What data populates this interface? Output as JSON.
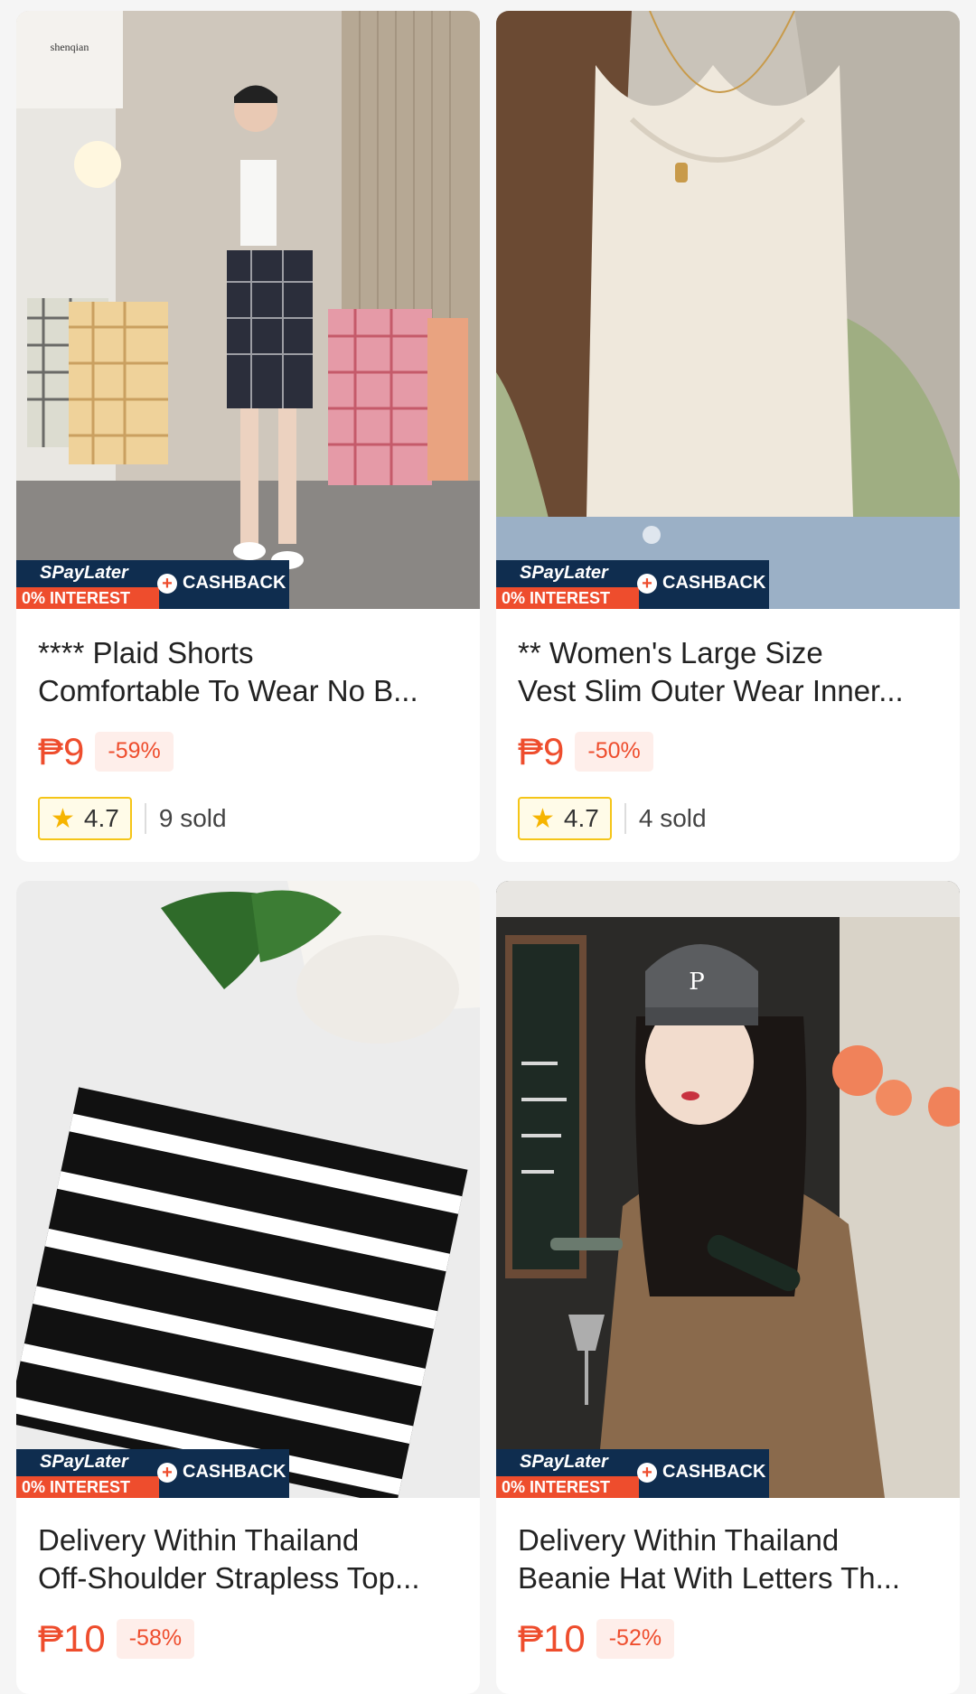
{
  "products": [
    {
      "title_line1": "**** Plaid Shorts",
      "title_line2": "Comfortable To Wear No B...",
      "price": "₱9",
      "discount": "-59%",
      "rating": "4.7",
      "sold": "9 sold",
      "badge": {
        "spaylater": "SPayLater",
        "interest": "0% INTEREST",
        "cashback": "CASHBACK"
      }
    },
    {
      "title_line1": "** Women's Large Size",
      "title_line2": "Vest Slim Outer Wear Inner...",
      "price": "₱9",
      "discount": "-50%",
      "rating": "4.7",
      "sold": "4 sold",
      "badge": {
        "spaylater": "SPayLater",
        "interest": "0% INTEREST",
        "cashback": "CASHBACK"
      }
    },
    {
      "title_line1": "Delivery Within Thailand",
      "title_line2": "Off-Shoulder Strapless Top...",
      "price": "₱10",
      "discount": "-58%",
      "badge": {
        "spaylater": "SPayLater",
        "interest": "0% INTEREST",
        "cashback": "CASHBACK"
      }
    },
    {
      "title_line1": "Delivery Within Thailand",
      "title_line2": "Beanie Hat With Letters Th...",
      "price": "₱10",
      "discount": "-52%",
      "badge": {
        "spaylater": "SPayLater",
        "interest": "0% INTEREST",
        "cashback": "CASHBACK"
      }
    }
  ],
  "brand_logo_text": "shenqian",
  "colors": {
    "accent": "#ee4d2d",
    "badge_navy": "#0f2d4f",
    "star": "#f6b400"
  }
}
